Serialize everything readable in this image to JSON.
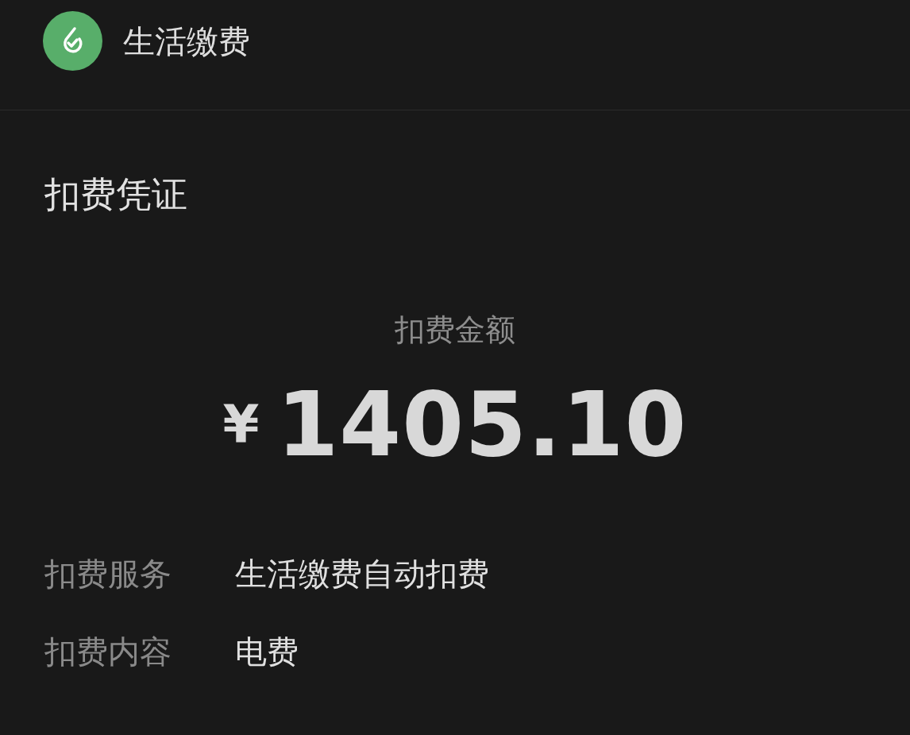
{
  "header": {
    "title": "生活缴费"
  },
  "section_title": "扣费凭证",
  "amount": {
    "label": "扣费金额",
    "currency": "¥",
    "value": "1405.10"
  },
  "details": [
    {
      "label": "扣费服务",
      "value": "生活缴费自动扣费"
    },
    {
      "label": "扣费内容",
      "value": "电费"
    }
  ]
}
